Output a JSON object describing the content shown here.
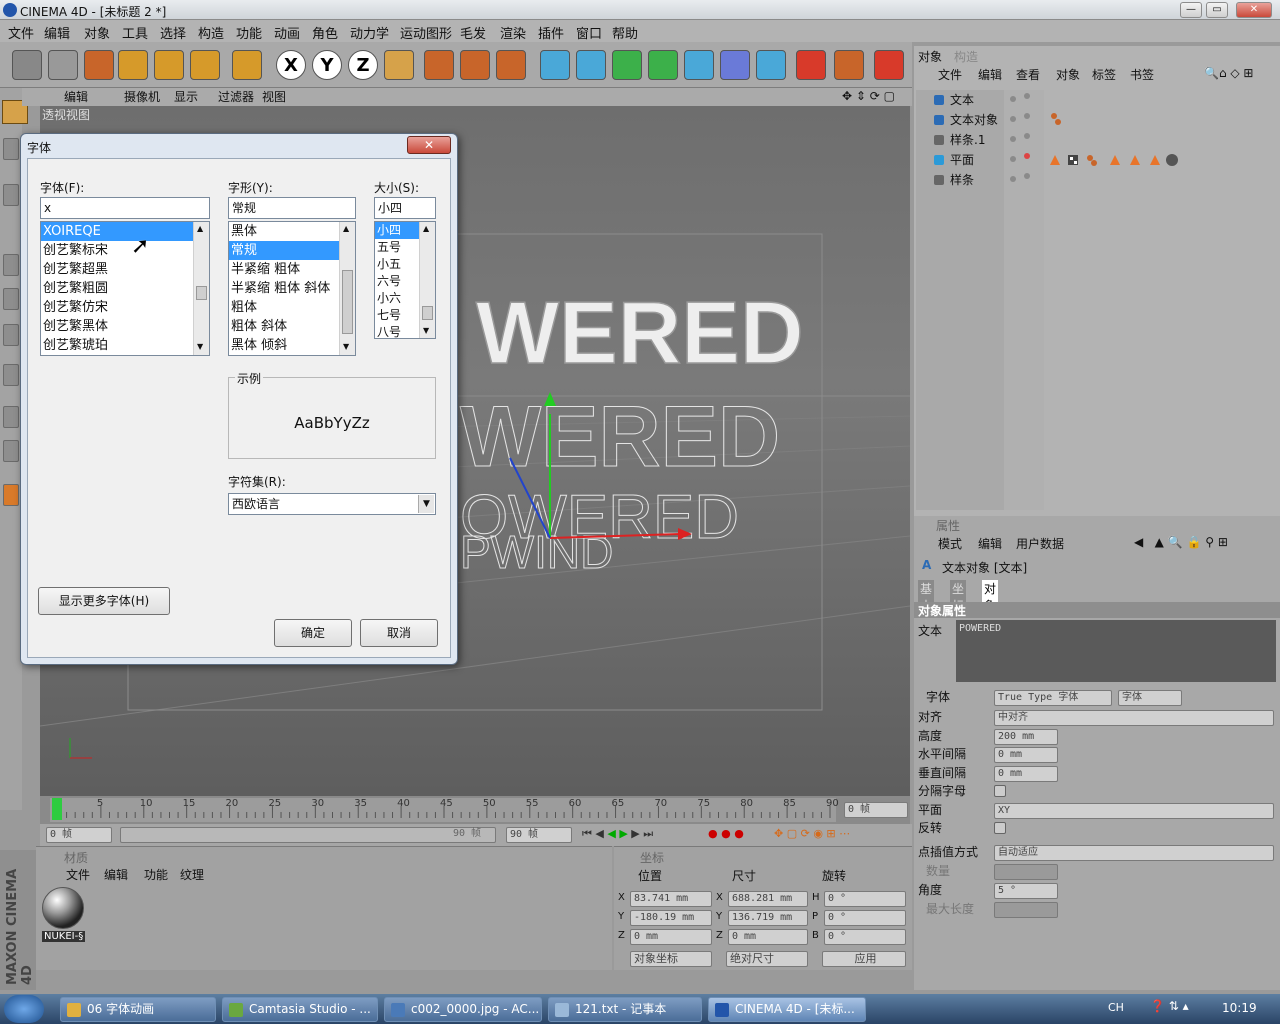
{
  "window": {
    "title": "CINEMA 4D - [未标题 2 *]"
  },
  "menu": [
    "文件",
    "编辑",
    "对象",
    "工具",
    "选择",
    "构造",
    "功能",
    "动画",
    "角色",
    "动力学",
    "运动图形",
    "毛发",
    "渲染",
    "插件",
    "窗口",
    "帮助"
  ],
  "toolbar_icons": [
    "undo-icon",
    "redo-icon",
    "live-select-icon",
    "move-icon",
    "scale-icon",
    "rotate-icon",
    "add-icon",
    "x-axis-icon",
    "y-axis-icon",
    "z-axis-icon",
    "world-coords-icon",
    "render-view-icon",
    "render-picture-icon",
    "render-settings-icon",
    "cube-icon",
    "spline-icon",
    "nurbs-icon",
    "array-icon",
    "deformer-icon",
    "scene-icon",
    "particle-icon",
    "help-icon",
    "layout-icon",
    "browser-icon"
  ],
  "toolbar_axis_labels": [
    "X",
    "Y",
    "Z"
  ],
  "viewport": {
    "menu": [
      "编辑",
      "摄像机",
      "显示",
      "过滤器",
      "视图"
    ],
    "name": "透视视图",
    "text_solid": "WERED",
    "text_outline": "WERED",
    "text_small": "OWERED",
    "text_bottom": "PWIND"
  },
  "timeline": {
    "ticks": [
      "0",
      "5",
      "10",
      "15",
      "20",
      "25",
      "30",
      "35",
      "40",
      "45",
      "50",
      "55",
      "60",
      "65",
      "70",
      "75",
      "80",
      "85",
      "90"
    ],
    "current_frame": "0 帧",
    "start": "0 帧",
    "end_field": "90 帧",
    "end_end": "90 帧"
  },
  "material_panel": {
    "title": "材质",
    "menu": [
      "文件",
      "编辑",
      "功能",
      "纹理"
    ],
    "material_name": "NUKEI-§"
  },
  "coord_panel": {
    "title": "坐标",
    "headers": [
      "位置",
      "尺寸",
      "旋转"
    ],
    "rows": [
      {
        "axis": "X",
        "pos": "83.741 mm",
        "size_axis": "X",
        "size": "688.281 mm",
        "rot_axis": "H",
        "rot": "0 °"
      },
      {
        "axis": "Y",
        "pos": "-180.19 mm",
        "size_axis": "Y",
        "size": "136.719 mm",
        "rot_axis": "P",
        "rot": "0 °"
      },
      {
        "axis": "Z",
        "pos": "0 mm",
        "size_axis": "Z",
        "size": "0 mm",
        "rot_axis": "B",
        "rot": "0 °"
      }
    ],
    "mode_select": "对象坐标",
    "size_select": "绝对尺寸",
    "apply": "应用"
  },
  "object_panel": {
    "tabs": [
      "对象",
      "构造"
    ],
    "menu": [
      "文件",
      "编辑",
      "查看",
      "对象",
      "标签",
      "书签"
    ],
    "items": [
      {
        "name": "文本"
      },
      {
        "name": "文本对象"
      },
      {
        "name": "样条.1"
      },
      {
        "name": "平面"
      },
      {
        "name": "样条"
      }
    ]
  },
  "attr_panel": {
    "title": "属性",
    "menu": [
      "模式",
      "编辑",
      "用户数据"
    ],
    "object": "文本对象 [文本]",
    "tabs": [
      "基本",
      "坐标",
      "对象"
    ],
    "section": "对象属性",
    "text_label": "文本",
    "text_value": "POWERED",
    "font_label": "字体",
    "font_type": "True Type 字体",
    "font_button": "字体",
    "fields": [
      {
        "label": "对齐",
        "value": "中对齐"
      },
      {
        "label": "高度",
        "value": "200 mm"
      },
      {
        "label": "水平间隔",
        "value": "0 mm"
      },
      {
        "label": "垂直间隔",
        "value": "0 mm"
      },
      {
        "label": "分隔字母",
        "value": ""
      },
      {
        "label": "平面",
        "value": "XY"
      },
      {
        "label": "反转",
        "value": ""
      }
    ],
    "interp_label": "点插值方式",
    "interp_value": "自动适应",
    "count_label": "数量",
    "angle_label": "角度",
    "angle_value": "5 °",
    "maxlen_label": "最大长度"
  },
  "font_dialog": {
    "title": "字体",
    "font_label": "字体(F):",
    "font_value": "x",
    "fonts": [
      "XOIREQE",
      "创艺繁标宋",
      "创艺繁超黑",
      "创艺繁粗圆",
      "创艺繁仿宋",
      "创艺繁黑体",
      "创艺繁琥珀"
    ],
    "style_label": "字形(Y):",
    "style_value": "常规",
    "styles": [
      "黑体",
      "常规",
      "半紧缩 粗体",
      "半紧缩 粗体 斜体",
      "粗体",
      "粗体 斜体",
      "黑体 倾斜"
    ],
    "size_label": "大小(S):",
    "size_value": "小四",
    "sizes": [
      "小四",
      "五号",
      "小五",
      "六号",
      "小六",
      "七号",
      "八号"
    ],
    "sample_label": "示例",
    "sample_text": "AaBbYyZz",
    "charset_label": "字符集(R):",
    "charset_value": "西欧语言",
    "more_fonts": "显示更多字体(H)",
    "ok": "确定",
    "cancel": "取消"
  },
  "logo": "MAXON CINEMA 4D",
  "taskbar": {
    "items": [
      "06 字体动画",
      "Camtasia Studio - ...",
      "c002_0000.jpg - AC...",
      "121.txt - 记事本",
      "CINEMA 4D - [未标..."
    ],
    "lang": "CH",
    "clock": "10:19"
  },
  "colors": {
    "selection": "#3399ff",
    "viewport_bg": "#6e6e6e",
    "taskbar": "#2a4466"
  }
}
